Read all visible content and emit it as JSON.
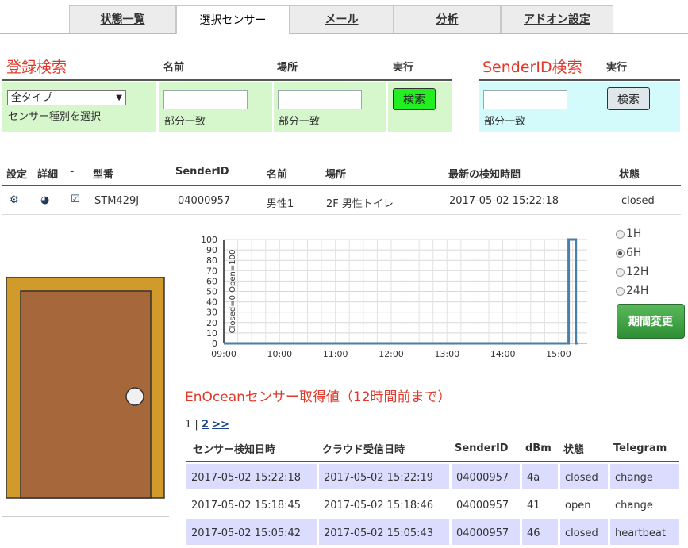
{
  "tabs": [
    "状態一覧",
    "選択センサー",
    "メール",
    "分析",
    "アドオン設定"
  ],
  "register_search": {
    "title": "登録検索",
    "col_name": "名前",
    "col_place": "場所",
    "col_exec": "実行",
    "select_value": "全タイプ",
    "select_hint": "センサー種別を選択",
    "name_hint": "部分一致",
    "place_hint": "部分一致",
    "button": "検索"
  },
  "sender_search": {
    "title": "SenderID検索",
    "col_exec": "実行",
    "hint": "部分一致",
    "button": "検索"
  },
  "sensor_table": {
    "headers": [
      "設定",
      "詳細",
      "-",
      "型番",
      "SenderID",
      "名前",
      "場所",
      "最新の検知時間",
      "状態"
    ],
    "row": {
      "model": "STM429J",
      "sender_id": "04000957",
      "name": "男性1",
      "place": "2F 男性トイレ",
      "last_detect": "2017-05-02 15:22:18",
      "status": "closed"
    }
  },
  "chart_data": {
    "type": "line",
    "ylabel": "Closed=0 Open=100",
    "ylim": [
      0,
      100
    ],
    "yticks": [
      "100",
      "90",
      "80",
      "70",
      "60",
      "50",
      "40",
      "30",
      "20",
      "10",
      "0"
    ],
    "xticks": [
      "09:00",
      "10:00",
      "11:00",
      "12:00",
      "13:00",
      "14:00",
      "15:00"
    ],
    "x_range_hours": [
      9.0,
      15.35
    ],
    "series": [
      {
        "color": "#4a7fa8",
        "points": [
          [
            9.0,
            0
          ],
          [
            15.18,
            0
          ],
          [
            15.18,
            100
          ],
          [
            15.31,
            100
          ],
          [
            15.31,
            0
          ],
          [
            15.35,
            0
          ]
        ]
      }
    ]
  },
  "periods": {
    "options": [
      "1H",
      "6H",
      "12H",
      "24H"
    ],
    "selected": "6H",
    "button": "期間変更"
  },
  "enocean": {
    "title": "EnOceanセンサー取得値（12時間前まで）",
    "pager_current": "1",
    "pager_sep": "|",
    "pager_page2": "2",
    "pager_next": ">>",
    "headers": [
      "センサー検知日時",
      "クラウド受信日時",
      "SenderID",
      "dBm",
      "状態",
      "Telegram"
    ],
    "rows": [
      [
        "2017-05-02 15:22:18",
        "2017-05-02 15:22:19",
        "04000957",
        "4a",
        "closed",
        "change"
      ],
      [
        "2017-05-02 15:18:45",
        "2017-05-02 15:18:46",
        "04000957",
        "41",
        "open",
        "change"
      ],
      [
        "2017-05-02 15:05:42",
        "2017-05-02 15:05:43",
        "04000957",
        "46",
        "closed",
        "heartbeat"
      ]
    ]
  }
}
